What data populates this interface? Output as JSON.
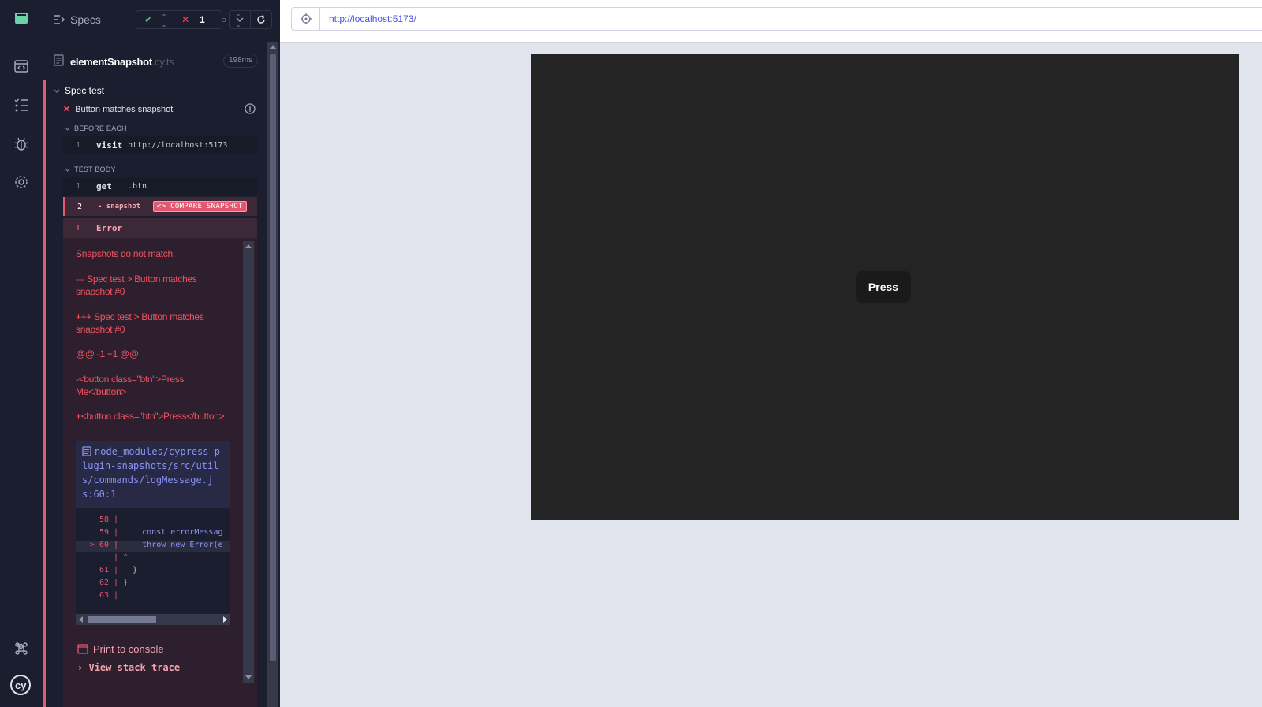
{
  "reporter": {
    "specs_label": "Specs",
    "stats": {
      "passed": "--",
      "failed": "1",
      "pending": "--"
    },
    "file": {
      "name": "elementSnapshot",
      "ext": ".cy.ts",
      "duration": "198ms"
    },
    "suite": "Spec test",
    "test": "Button matches snapshot",
    "before_each_label": "BEFORE EACH",
    "test_body_label": "TEST BODY",
    "before_commands": [
      {
        "num": "1",
        "name": "visit",
        "message": "http://localhost:5173"
      }
    ],
    "body_commands": [
      {
        "num": "1",
        "name": "get",
        "message": ".btn"
      },
      {
        "num": "2",
        "name": "- snapshot",
        "badge": "<> COMPARE SNAPSHOT"
      }
    ],
    "error": {
      "title": "Error",
      "bang": "!",
      "lines": [
        "Snapshots do not match:",
        "--- Spec test > Button matches snapshot #0",
        "+++ Spec test > Button matches snapshot #0",
        "@@ -1 +1 @@",
        "-<button class=\"btn\">Press Me</button>",
        "+<button class=\"btn\">Press</button>"
      ],
      "stack_file": "node_modules/cypress-plugin-snapshots/src/utils/commands/logMessage.js:60:1",
      "code": [
        {
          "ln": "58",
          "text": ""
        },
        {
          "ln": "59",
          "text": "    const errorMessag"
        },
        {
          "ln": "60",
          "text": "    throw new Error(e",
          "current": true
        },
        {
          "ln": "",
          "text": "^"
        },
        {
          "ln": "61",
          "text": "  }"
        },
        {
          "ln": "62",
          "text": "}"
        },
        {
          "ln": "63",
          "text": ""
        }
      ],
      "print_label": "Print to console",
      "stack_label": "View stack trace"
    }
  },
  "aut": {
    "url": "http://localhost:5173/",
    "button_label": "Press"
  }
}
